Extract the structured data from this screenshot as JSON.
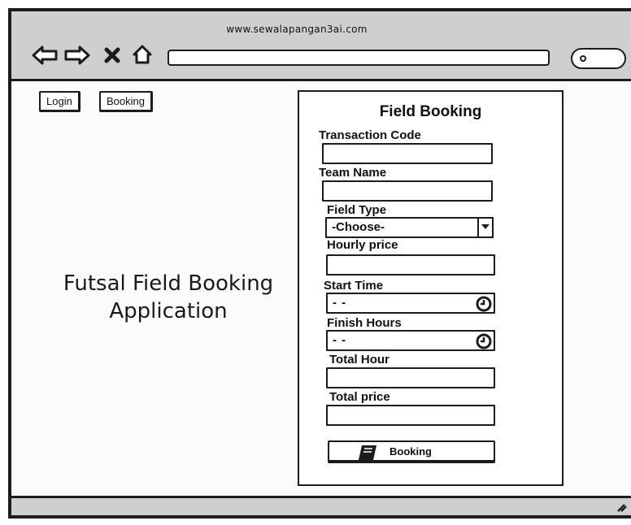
{
  "browser": {
    "url": "www.sewalapangan3ai.com",
    "icons": [
      "back-arrow-icon",
      "forward-arrow-icon",
      "close-icon",
      "home-icon",
      "search-icon",
      "resize-grip-icon"
    ]
  },
  "nav": {
    "login_label": "Login",
    "booking_label": "Booking"
  },
  "hero": {
    "line1": "Futsal Field Booking",
    "line2": "Application"
  },
  "form": {
    "title": "Field Booking",
    "transaction_code_label": "Transaction Code",
    "team_name_label": "Team Name",
    "field_type_label": "Field Type",
    "field_type_value": "-Choose-",
    "hourly_price_label": "Hourly price",
    "start_time_label": "Start Time",
    "start_time_value": "- -",
    "finish_hours_label": "Finish Hours",
    "finish_hours_value": "- -",
    "total_hour_label": "Total Hour",
    "total_price_label": "Total price",
    "submit_label": "Booking"
  }
}
